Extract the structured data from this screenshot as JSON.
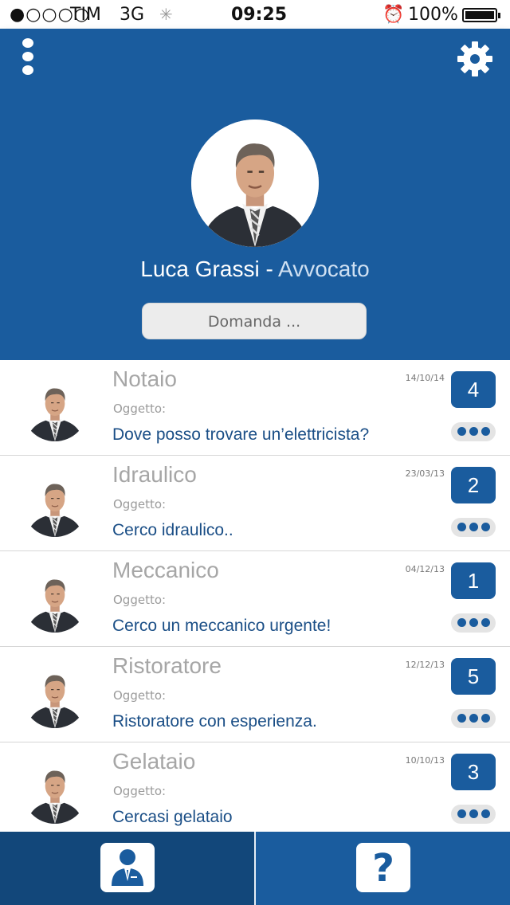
{
  "status_bar": {
    "signal": "●○○○○",
    "carrier": "TIM",
    "network": "3G",
    "time": "09:25",
    "battery_pct": "100%",
    "icons": [
      "signal-icon",
      "loading-spinner-icon",
      "alarm-icon",
      "battery-icon"
    ]
  },
  "header": {
    "menu_icon": "vertical-dots-icon",
    "settings_icon": "gear-icon",
    "profile": {
      "name": "Luca Grassi",
      "separator": " - ",
      "role": "Avvocato"
    },
    "ask_button": {
      "label": "Domanda ..."
    }
  },
  "list": {
    "subject_label": "Oggetto:",
    "items": [
      {
        "title": "Notaio",
        "subject": "Dove posso trovare un’elettricista?",
        "date": "14/10/14",
        "count": "4"
      },
      {
        "title": "Idraulico",
        "subject": "Cerco idraulico..",
        "date": "23/03/13",
        "count": "2"
      },
      {
        "title": "Meccanico",
        "subject": "Cerco un meccanico urgente!",
        "date": "04/12/13",
        "count": "1"
      },
      {
        "title": "Ristoratore",
        "subject": "Ristoratore con esperienza.",
        "date": "12/12/13",
        "count": "5"
      },
      {
        "title": "Gelataio",
        "subject": "Cercasi gelataio",
        "date": "10/10/13",
        "count": "3"
      }
    ]
  },
  "tab_bar": {
    "tabs": [
      {
        "icon": "businessman-icon",
        "active": true
      },
      {
        "icon": "question-mark-icon",
        "active": false,
        "glyph": "?"
      }
    ]
  },
  "colors": {
    "primary_blue": "#1a5c9e",
    "dark_blue": "#12477a",
    "subject_text": "#1a4e86",
    "title_gray": "#a6a6a6"
  }
}
